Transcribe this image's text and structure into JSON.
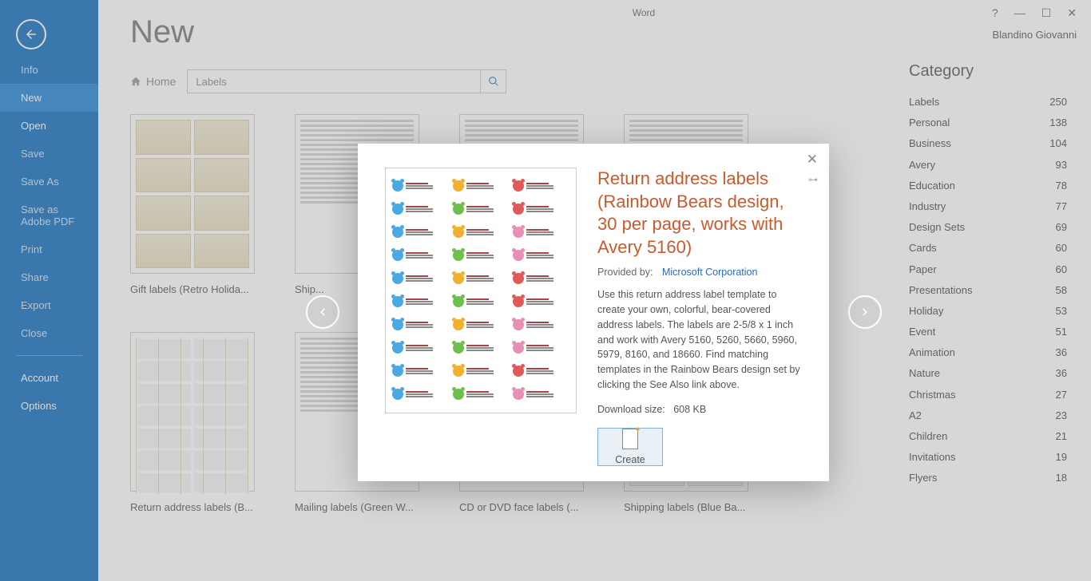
{
  "app_title": "Word",
  "user_name": "Blandino Giovanni",
  "sidebar": {
    "items": [
      "Info",
      "New",
      "Open",
      "Save",
      "Save As",
      "Save as Adobe PDF",
      "Print",
      "Share",
      "Export",
      "Close"
    ],
    "footer": [
      "Account",
      "Options"
    ],
    "active_index": 1
  },
  "page": {
    "title": "New"
  },
  "breadcrumb": {
    "home": "Home"
  },
  "search": {
    "value": "Labels"
  },
  "templates": [
    {
      "caption": "Gift labels (Retro Holida..."
    },
    {
      "caption": "Ship..."
    },
    {
      "caption": ""
    },
    {
      "caption": ""
    },
    {
      "caption": "Return address labels (B..."
    },
    {
      "caption": "Mailing labels (Green W..."
    },
    {
      "caption": "CD or DVD face labels (..."
    },
    {
      "caption": "Shipping labels (Blue Ba..."
    }
  ],
  "category": {
    "title": "Category",
    "items": [
      {
        "name": "Labels",
        "count": 250
      },
      {
        "name": "Personal",
        "count": 138
      },
      {
        "name": "Business",
        "count": 104
      },
      {
        "name": "Avery",
        "count": 93
      },
      {
        "name": "Education",
        "count": 78
      },
      {
        "name": "Industry",
        "count": 77
      },
      {
        "name": "Design Sets",
        "count": 69
      },
      {
        "name": "Cards",
        "count": 60
      },
      {
        "name": "Paper",
        "count": 60
      },
      {
        "name": "Presentations",
        "count": 58
      },
      {
        "name": "Holiday",
        "count": 53
      },
      {
        "name": "Event",
        "count": 51
      },
      {
        "name": "Animation",
        "count": 36
      },
      {
        "name": "Nature",
        "count": 36
      },
      {
        "name": "Christmas",
        "count": 27
      },
      {
        "name": "A2",
        "count": 23
      },
      {
        "name": "Children",
        "count": 21
      },
      {
        "name": "Invitations",
        "count": 19
      },
      {
        "name": "Flyers",
        "count": 18
      }
    ]
  },
  "modal": {
    "title": "Return address labels (Rainbow Bears design, 30 per page, works with Avery 5160)",
    "provided_label": "Provided by:",
    "provider": "Microsoft Corporation",
    "description": "Use this return address label template to create your own, colorful, bear-covered address labels. The labels are 2-5/8 x 1 inch and work with Avery 5160, 5260, 5660, 5960, 5979, 8160, and 18660. Find matching templates in the Rainbow Bears design set by clicking the See Also link above.",
    "download_label": "Download size:",
    "download_size": "608 KB",
    "create": "Create",
    "bear_colors": [
      "#4aa9e0",
      "#f0b030",
      "#e05a5a",
      "#4aa9e0",
      "#6fbf4f",
      "#e05a5a",
      "#4aa9e0",
      "#f0b030",
      "#e88fb6",
      "#4aa9e0",
      "#6fbf4f",
      "#e88fb6",
      "#4aa9e0",
      "#f0b030",
      "#e05a5a",
      "#4aa9e0",
      "#6fbf4f",
      "#e05a5a",
      "#4aa9e0",
      "#f0b030",
      "#e88fb6",
      "#4aa9e0",
      "#6fbf4f",
      "#e88fb6",
      "#4aa9e0",
      "#f0b030",
      "#e05a5a",
      "#4aa9e0",
      "#6fbf4f",
      "#e88fb6"
    ]
  }
}
